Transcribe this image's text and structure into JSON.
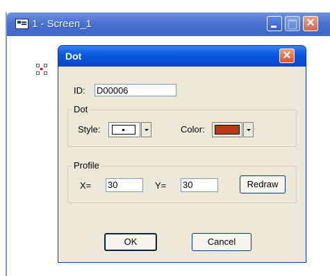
{
  "outer_window": {
    "title": "1 - Screen_1",
    "icon": "app-window-icon",
    "buttons": {
      "minimize": "minimize-icon",
      "maximize": "maximize-icon",
      "close": "close-icon",
      "close_glyph": "✕"
    }
  },
  "dialog": {
    "title": "Dot",
    "close_glyph": "✕",
    "id_label": "ID:",
    "id_value": "D00006",
    "dot_group": {
      "legend": "Dot",
      "style_label": "Style:",
      "color_label": "Color:",
      "color_value": "#b23a17"
    },
    "profile_group": {
      "legend": "Profile",
      "x_label": "X=",
      "x_value": "30",
      "y_label": "Y=",
      "y_value": "30",
      "redraw_label": "Redraw"
    },
    "ok_label": "OK",
    "cancel_label": "Cancel"
  },
  "colors": {
    "dialog_bg": "#ece9d8",
    "titlebar_blue": "#0a5ae0",
    "dot_color": "#b23a17"
  }
}
